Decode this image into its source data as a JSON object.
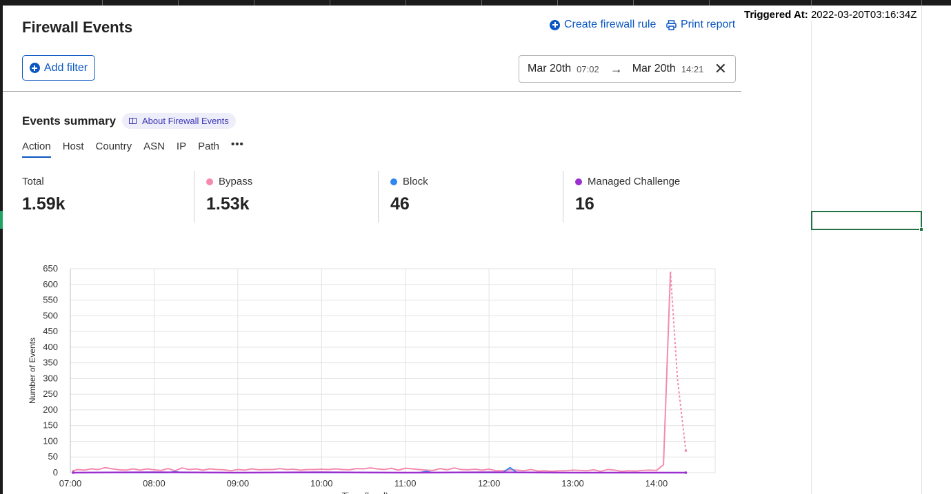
{
  "sheet": {
    "triggered_label": "Triggered At:",
    "triggered_value": "2022-03-20T03:16:34Z"
  },
  "header": {
    "title": "Firewall Events",
    "create_rule": "Create firewall rule",
    "print_report": "Print report"
  },
  "filters": {
    "add_filter": "Add filter",
    "range": {
      "from_date": "Mar 20th",
      "from_time": "07:02",
      "arrow": "→",
      "to_date": "Mar 20th",
      "to_time": "14:21",
      "close": "✕"
    }
  },
  "summary": {
    "title": "Events summary",
    "about": "About Firewall Events",
    "tabs": [
      "Action",
      "Host",
      "Country",
      "ASN",
      "IP",
      "Path"
    ],
    "more": "•••",
    "metrics": [
      {
        "label": "Total",
        "value": "1.59k",
        "color": ""
      },
      {
        "label": "Bypass",
        "value": "1.53k",
        "color": "#f48aad"
      },
      {
        "label": "Block",
        "value": "46",
        "color": "#2f86f0"
      },
      {
        "label": "Managed Challenge",
        "value": "16",
        "color": "#9b2fd0"
      }
    ]
  },
  "chart_data": {
    "type": "line",
    "title": "",
    "xlabel": "Time (local)",
    "ylabel": "Number of Events",
    "x_ticks": [
      "07:00",
      "08:00",
      "09:00",
      "10:00",
      "11:00",
      "12:00",
      "13:00",
      "14:00"
    ],
    "y_ticks": [
      0,
      50,
      100,
      150,
      200,
      250,
      300,
      350,
      400,
      450,
      500,
      550,
      600,
      650
    ],
    "xlim": [
      "07:00",
      "14:21"
    ],
    "ylim": [
      0,
      650
    ],
    "grid": true,
    "series": [
      {
        "name": "Bypass",
        "color": "#f48aad",
        "x": [
          "07:02",
          "07:05",
          "07:10",
          "07:15",
          "07:20",
          "07:25",
          "07:30",
          "07:35",
          "07:40",
          "07:45",
          "07:50",
          "07:55",
          "08:00",
          "08:05",
          "08:10",
          "08:15",
          "08:20",
          "08:25",
          "08:30",
          "08:35",
          "08:40",
          "08:45",
          "08:50",
          "08:55",
          "09:00",
          "09:05",
          "09:10",
          "09:15",
          "09:20",
          "09:25",
          "09:30",
          "09:35",
          "09:40",
          "09:45",
          "09:50",
          "09:55",
          "10:00",
          "10:05",
          "10:10",
          "10:15",
          "10:20",
          "10:25",
          "10:30",
          "10:35",
          "10:40",
          "10:45",
          "10:50",
          "10:55",
          "11:00",
          "11:05",
          "11:10",
          "11:15",
          "11:20",
          "11:25",
          "11:30",
          "11:35",
          "11:40",
          "11:45",
          "11:50",
          "11:55",
          "12:00",
          "12:05",
          "12:10",
          "12:15",
          "12:20",
          "12:25",
          "12:30",
          "12:35",
          "12:40",
          "12:45",
          "12:50",
          "12:55",
          "13:00",
          "13:05",
          "13:10",
          "13:15",
          "13:20",
          "13:25",
          "13:30",
          "13:35",
          "13:40",
          "13:45",
          "13:50",
          "13:55",
          "14:00",
          "14:05",
          "14:10",
          "14:15",
          "14:21"
        ],
        "values": [
          5,
          10,
          8,
          12,
          10,
          16,
          12,
          9,
          8,
          12,
          8,
          12,
          9,
          7,
          13,
          6,
          15,
          10,
          12,
          8,
          12,
          10,
          9,
          6,
          10,
          8,
          12,
          9,
          10,
          10,
          13,
          10,
          11,
          8,
          10,
          10,
          11,
          10,
          12,
          10,
          9,
          13,
          12,
          15,
          12,
          10,
          14,
          8,
          14,
          12,
          10,
          8,
          7,
          13,
          9,
          15,
          10,
          9,
          11,
          8,
          11,
          6,
          6,
          9,
          8,
          6,
          10,
          5,
          6,
          4,
          6,
          6,
          8,
          7,
          6,
          9,
          4,
          10,
          8,
          4,
          6,
          5,
          7,
          8,
          7,
          25,
          640,
          300,
          70
        ]
      },
      {
        "name": "Block",
        "color": "#2f86f0",
        "x": [
          "07:02",
          "08:10",
          "08:15",
          "08:20",
          "09:00",
          "10:00",
          "11:00",
          "11:10",
          "11:15",
          "11:20",
          "12:00",
          "12:10",
          "12:15",
          "12:20",
          "13:00",
          "14:00",
          "14:21"
        ],
        "values": [
          0,
          0,
          3,
          0,
          0,
          0,
          0,
          0,
          4,
          0,
          0,
          0,
          16,
          0,
          0,
          0,
          0
        ]
      },
      {
        "name": "Managed Challenge",
        "color": "#9b2fd0",
        "x": [
          "07:02",
          "08:00",
          "09:00",
          "10:00",
          "11:00",
          "12:00",
          "13:00",
          "14:00",
          "14:21"
        ],
        "values": [
          0,
          1,
          0,
          1,
          0,
          1,
          0,
          0,
          0
        ]
      }
    ]
  }
}
